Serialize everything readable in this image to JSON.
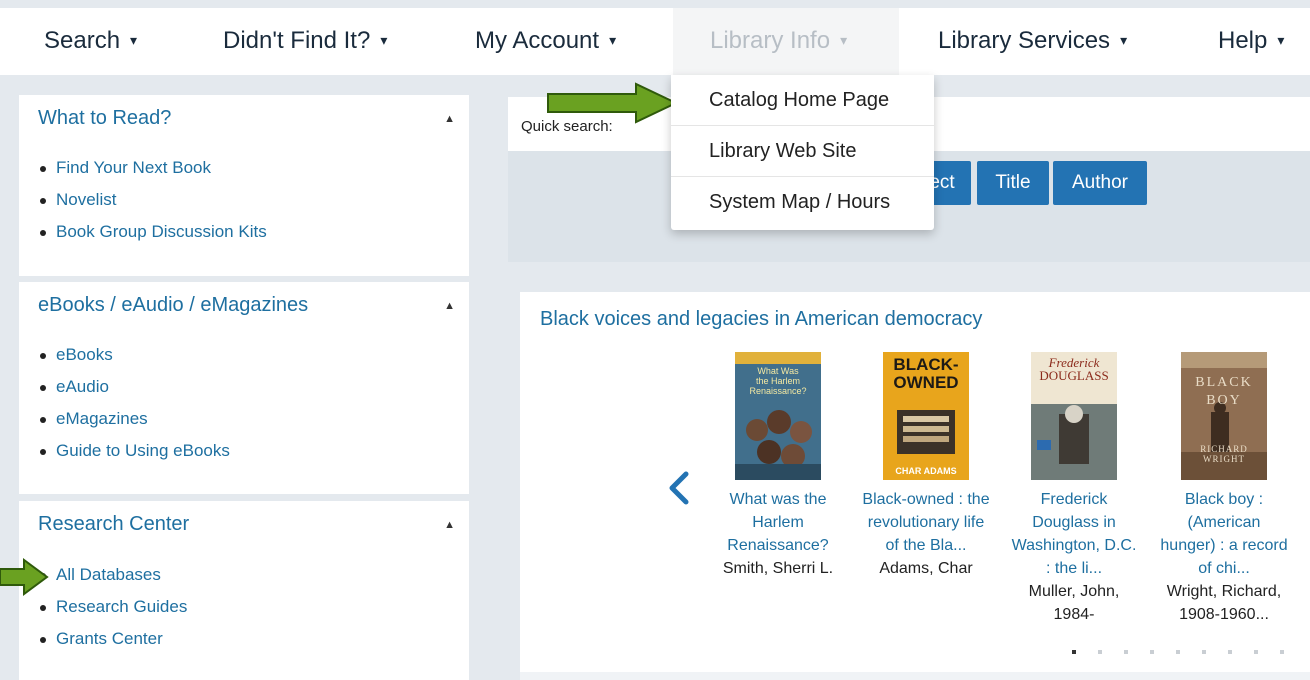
{
  "nav": {
    "items": [
      {
        "label": "Search",
        "caret": "▾"
      },
      {
        "label": "Didn't Find It?",
        "caret": "▾"
      },
      {
        "label": "My Account",
        "caret": "▾"
      },
      {
        "label": "Library Info",
        "caret": "▾"
      },
      {
        "label": "Library Services",
        "caret": "▾"
      },
      {
        "label": "Help",
        "caret": "▾"
      }
    ]
  },
  "dropdown": {
    "items": [
      "Catalog Home Page",
      "Library Web Site",
      "System Map / Hours"
    ]
  },
  "sidebar": {
    "panels": [
      {
        "title": "What to Read?",
        "items": [
          "Find Your Next Book",
          "Novelist",
          "Book Group Discussion Kits"
        ]
      },
      {
        "title": "eBooks / eAudio / eMagazines",
        "items": [
          "eBooks",
          "eAudio",
          "eMagazines",
          "Guide to Using eBooks"
        ]
      },
      {
        "title": "Research Center",
        "items": [
          "All Databases",
          "Research Guides",
          "Grants Center"
        ]
      }
    ],
    "collapse_icon": "caret-up-icon"
  },
  "quick_search": {
    "label": "Quick search:",
    "buttons": [
      "ect",
      "Title",
      "Author"
    ]
  },
  "carousel": {
    "title": "Black voices and legacies in American democracy",
    "books": [
      {
        "title_lines": [
          "What was the",
          "Harlem",
          "Renaissance?"
        ],
        "author_lines": [
          "Smith, Sherri L."
        ],
        "cover_text": [
          "What Was",
          "the Harlem",
          "Renaissance?"
        ]
      },
      {
        "title_lines": [
          "Black-owned : the",
          "revolutionary life",
          "of the Bla..."
        ],
        "author_lines": [
          "Adams, Char"
        ],
        "cover_text": [
          "BLACK-",
          "OWNED",
          "CHAR ADAMS"
        ]
      },
      {
        "title_lines": [
          "Frederick",
          "Douglass in",
          "Washington, D.C.",
          ": the li..."
        ],
        "author_lines": [
          "Muller, John,",
          "1984-"
        ],
        "cover_text": [
          "Frederick",
          "DOUGLASS"
        ]
      },
      {
        "title_lines": [
          "Black boy :",
          "(American",
          "hunger) : a record",
          "of chi..."
        ],
        "author_lines": [
          "Wright, Richard,",
          "1908-1960..."
        ],
        "cover_text": [
          "BLACK",
          "BOY",
          "RICHARD",
          "WRIGHT"
        ]
      }
    ],
    "page_count": 9,
    "active_page": 1
  },
  "colors": {
    "link": "#1e6fa0",
    "button": "#2373b3",
    "arrow": "#6aa121",
    "background": "#e4e9ee"
  }
}
